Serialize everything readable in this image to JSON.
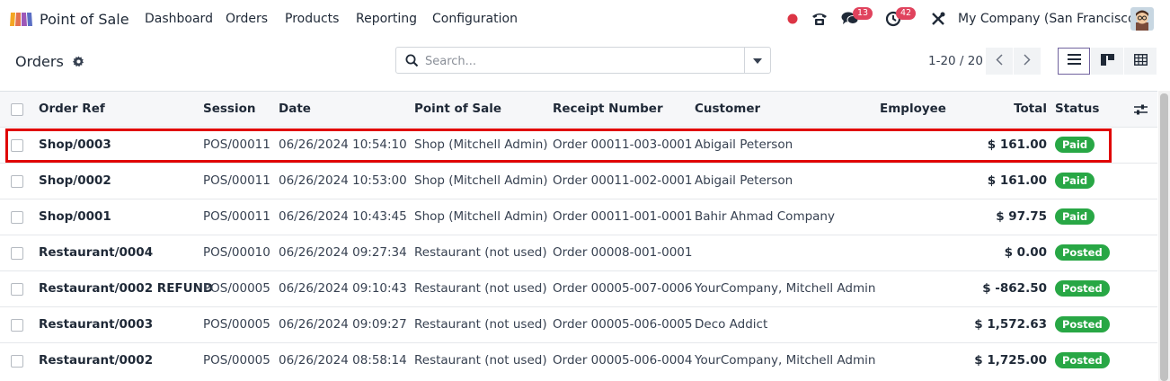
{
  "navbar": {
    "app_title": "Point of Sale",
    "menu": [
      "Dashboard",
      "Orders",
      "Products",
      "Reporting",
      "Configuration"
    ],
    "messages_count": "13",
    "activities_count": "42",
    "company": "My Company (San Francisco)",
    "icons": [
      "app-logo-icon",
      "status-dot-icon",
      "phone-icon",
      "chat-icon",
      "clock-icon",
      "tools-icon",
      "user-avatar"
    ]
  },
  "control_panel": {
    "title": "Orders",
    "search": {
      "placeholder": "Search...",
      "value": ""
    },
    "pager": "1-20 / 20",
    "views": [
      "list",
      "kanban",
      "pivot"
    ],
    "active_view": "list"
  },
  "table": {
    "headers": {
      "ref": "Order Ref",
      "session": "Session",
      "date": "Date",
      "pos": "Point of Sale",
      "receipt": "Receipt Number",
      "customer": "Customer",
      "employee": "Employee",
      "total": "Total",
      "status": "Status"
    },
    "rows": [
      {
        "ref": "Shop/0003",
        "session": "POS/00011",
        "date": "06/26/2024 10:54:10",
        "pos": "Shop (Mitchell Admin)",
        "receipt": "Order 00011-003-0001",
        "customer": "Abigail Peterson",
        "employee": "",
        "total": "$ 161.00",
        "status": "Paid"
      },
      {
        "ref": "Shop/0002",
        "session": "POS/00011",
        "date": "06/26/2024 10:53:00",
        "pos": "Shop (Mitchell Admin)",
        "receipt": "Order 00011-002-0001",
        "customer": "Abigail Peterson",
        "employee": "",
        "total": "$ 161.00",
        "status": "Paid"
      },
      {
        "ref": "Shop/0001",
        "session": "POS/00011",
        "date": "06/26/2024 10:43:45",
        "pos": "Shop (Mitchell Admin)",
        "receipt": "Order 00011-001-0001",
        "customer": "Bahir Ahmad Company",
        "employee": "",
        "total": "$ 97.75",
        "status": "Paid"
      },
      {
        "ref": "Restaurant/0004",
        "session": "POS/00010",
        "date": "06/26/2024 09:27:34",
        "pos": "Restaurant (not used)",
        "receipt": "Order 00008-001-0001",
        "customer": "",
        "employee": "",
        "total": "$ 0.00",
        "status": "Posted"
      },
      {
        "ref": "Restaurant/0002 REFUND",
        "session": "POS/00005",
        "date": "06/26/2024 09:10:43",
        "pos": "Restaurant (not used)",
        "receipt": "Order 00005-007-0006",
        "customer": "YourCompany, Mitchell Admin",
        "employee": "",
        "total": "$ -862.50",
        "status": "Posted"
      },
      {
        "ref": "Restaurant/0003",
        "session": "POS/00005",
        "date": "06/26/2024 09:09:27",
        "pos": "Restaurant (not used)",
        "receipt": "Order 00005-006-0005",
        "customer": "Deco Addict",
        "employee": "",
        "total": "$ 1,572.63",
        "status": "Posted"
      },
      {
        "ref": "Restaurant/0002",
        "session": "POS/00005",
        "date": "06/26/2024 08:58:14",
        "pos": "Restaurant (not used)",
        "receipt": "Order 00005-006-0004",
        "customer": "YourCompany, Mitchell Admin",
        "employee": "",
        "total": "$ 1,725.00",
        "status": "Posted"
      }
    ]
  },
  "colors": {
    "brand": "#71639e",
    "status_green": "#28a745",
    "badge_red": "#e0435d",
    "highlight_red": "#e00000"
  }
}
